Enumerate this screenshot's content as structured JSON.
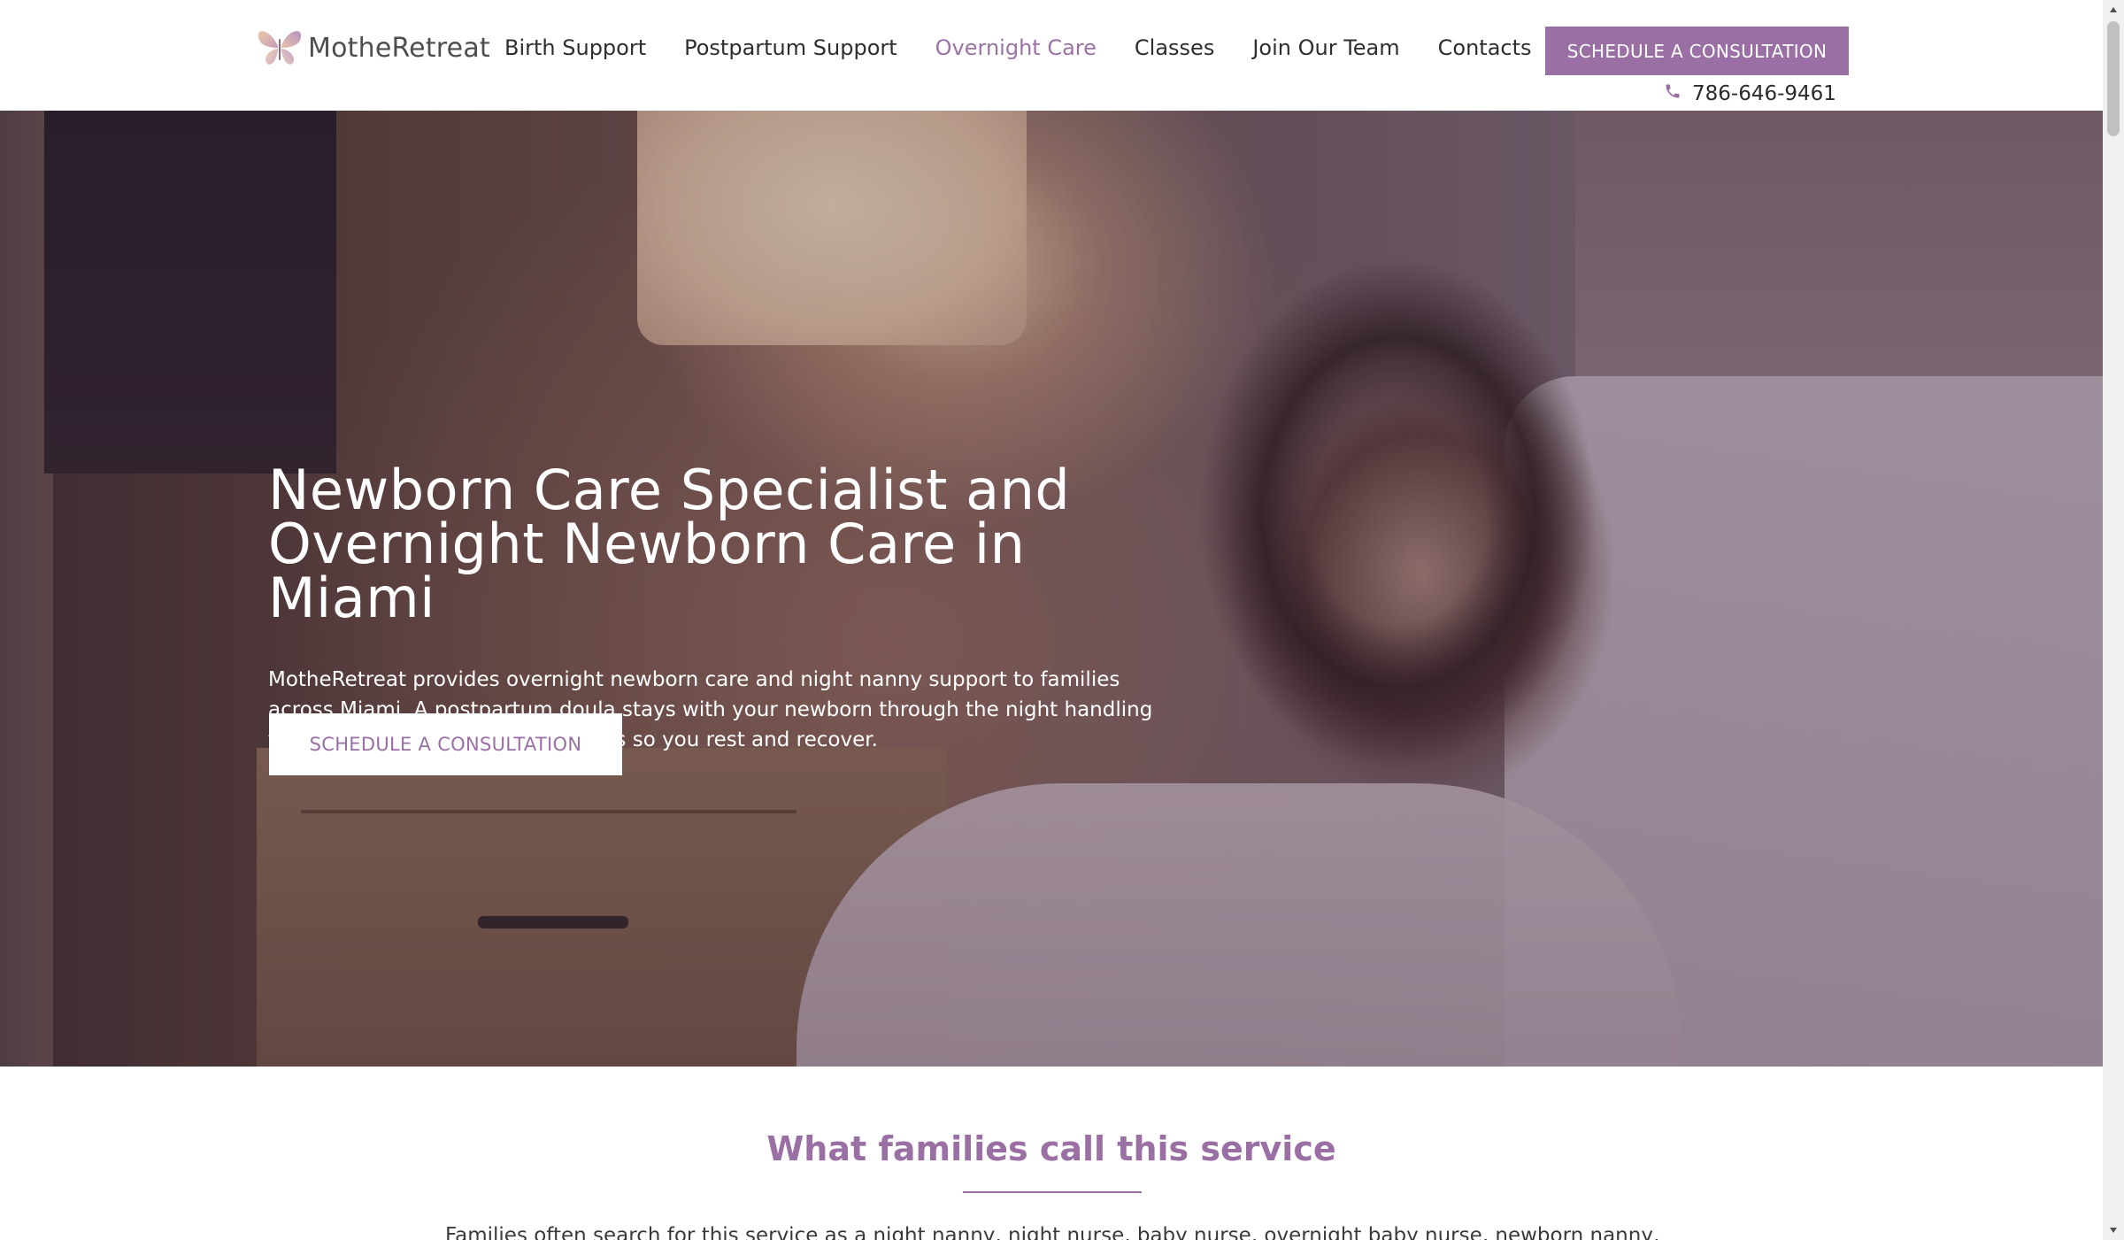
{
  "brand": {
    "name": "MotheRetreat",
    "logo_icon": "butterfly-icon",
    "accent_color": "#9a6fa4"
  },
  "nav": {
    "items": [
      {
        "label": "Birth Support"
      },
      {
        "label": "Postpartum Support"
      },
      {
        "label": "Overnight Care",
        "active": true
      },
      {
        "label": "Classes"
      },
      {
        "label": "Join Our Team"
      },
      {
        "label": "Contacts"
      }
    ],
    "cta_label": "SCHEDULE A CONSULTATION",
    "phone_icon": "phone-icon",
    "phone": "786-646-9461"
  },
  "hero": {
    "title": "Newborn Care Specialist and Overnight Newborn Care in Miami",
    "text": "MotheRetreat provides overnight newborn care and night nanny support to families across Miami. A postpartum doula stays with your newborn through the night handling feeds, soothing, and sleep routines so you rest and recover.",
    "cta_label": "SCHEDULE A CONSULTATION"
  },
  "section": {
    "title": "What families call this service",
    "text": "Families often search for this service as a night nanny, night nurse, baby nurse, overnight baby nurse, newborn nanny,"
  }
}
